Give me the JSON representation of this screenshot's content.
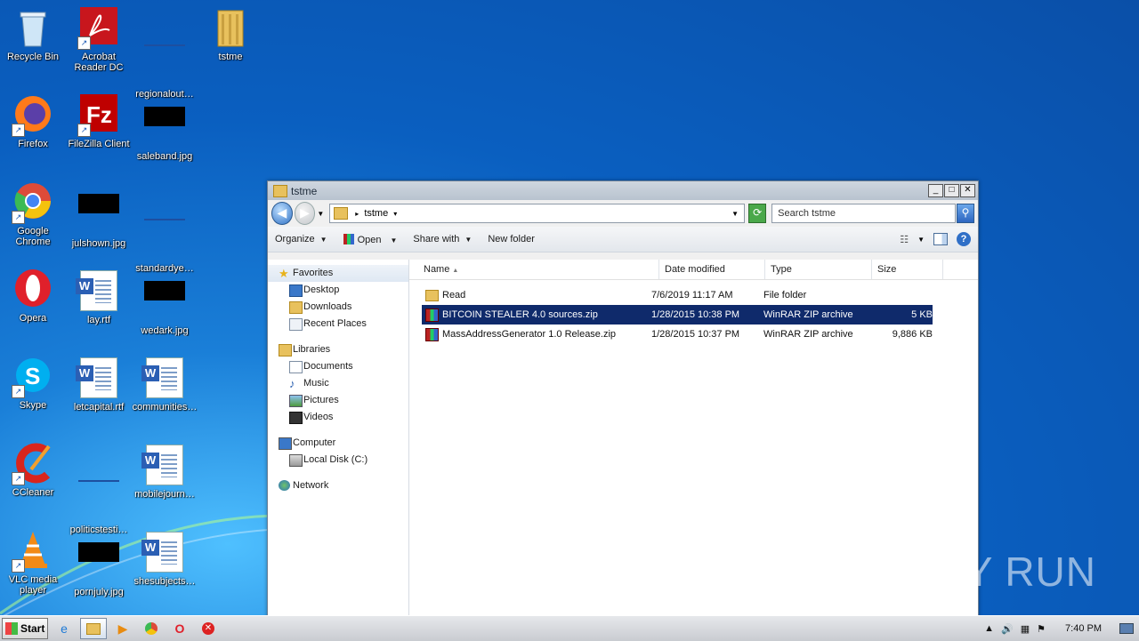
{
  "desktop": {
    "icons": [
      {
        "label": "Recycle Bin"
      },
      {
        "label": "Acrobat Reader DC"
      },
      {
        "label": "regionalout…"
      },
      {
        "label": "tstme"
      },
      {
        "label": "Firefox"
      },
      {
        "label": "FileZilla Client"
      },
      {
        "label": "saleband.jpg"
      },
      {
        "label": "Google Chrome"
      },
      {
        "label": "julshown.jpg"
      },
      {
        "label": "standardye…"
      },
      {
        "label": "Opera"
      },
      {
        "label": "lay.rtf"
      },
      {
        "label": "wedark.jpg"
      },
      {
        "label": "Skype"
      },
      {
        "label": "letcapital.rtf"
      },
      {
        "label": "communities…"
      },
      {
        "label": "CCleaner"
      },
      {
        "label": "politicstesti…"
      },
      {
        "label": "mobilejourn…"
      },
      {
        "label": "VLC media player"
      },
      {
        "label": "pornjuly.jpg"
      },
      {
        "label": "shesubjects…"
      }
    ]
  },
  "window": {
    "title": "tstme",
    "address": {
      "crumb": "tstme"
    },
    "search": {
      "placeholder": "Search tstme"
    },
    "commands": {
      "organize": "Organize",
      "open": "Open",
      "share_with": "Share with",
      "new_folder": "New folder"
    },
    "nav": {
      "favorites": "Favorites",
      "desktop": "Desktop",
      "downloads": "Downloads",
      "recent_places": "Recent Places",
      "libraries": "Libraries",
      "documents": "Documents",
      "music": "Music",
      "pictures": "Pictures",
      "videos": "Videos",
      "computer": "Computer",
      "local_disk": "Local Disk (C:)",
      "network": "Network"
    },
    "columns": {
      "name": "Name",
      "date": "Date modified",
      "type": "Type",
      "size": "Size"
    },
    "files": [
      {
        "name": "Read",
        "date": "7/6/2019 11:17 AM",
        "type": "File folder",
        "size": ""
      },
      {
        "name": "BITCOIN STEALER 4.0 sources.zip",
        "date": "1/28/2015 10:38 PM",
        "type": "WinRAR ZIP archive",
        "size": "5 KB"
      },
      {
        "name": "MassAddressGenerator 1.0 Release.zip",
        "date": "1/28/2015 10:37 PM",
        "type": "WinRAR ZIP archive",
        "size": "9,886 KB"
      }
    ]
  },
  "watermark": "ANY RUN",
  "taskbar": {
    "start": "Start",
    "clock": "7:40 PM"
  }
}
